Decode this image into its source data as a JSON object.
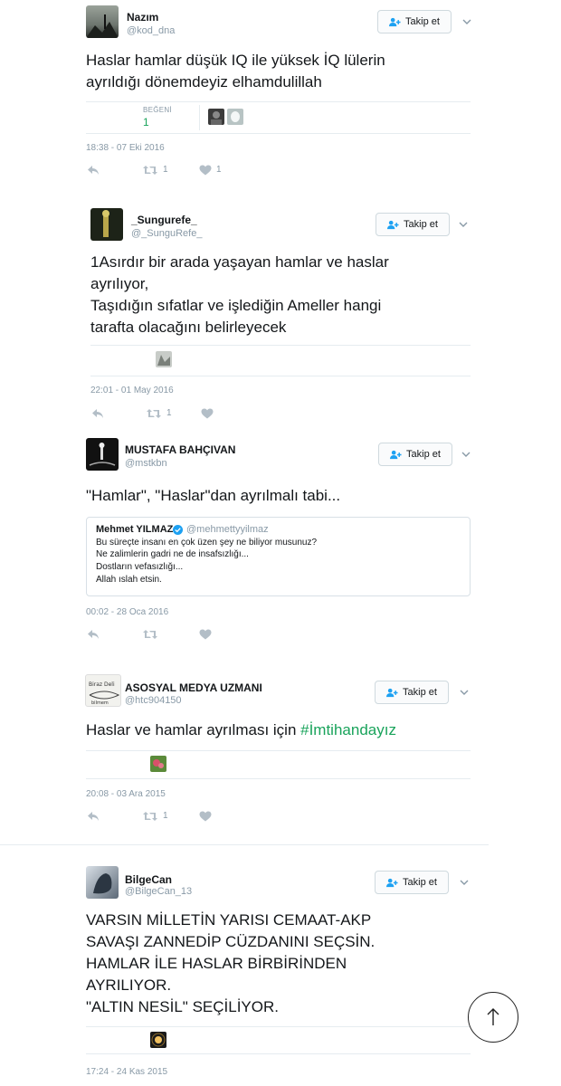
{
  "follow_label": "Takip et",
  "likes_label": "BEĞENİ",
  "colors": {
    "link": "#19a35b",
    "muted": "#8899a6",
    "text": "#14171a",
    "border": "#e6ecf0"
  },
  "tweets": [
    {
      "name": "Nazım",
      "handle": "@kod_dna",
      "lines": [
        "Haslar hamlar düşük IQ ile yüksek İQ lülerin",
        "ayrıldığı dönemdeyiz elhamdulillah"
      ],
      "likes_count": "1",
      "date": "18:38 - 07 Eki 2016",
      "retweets": "1",
      "likes": "1"
    },
    {
      "name": "_Sungurefe_",
      "handle": "@_SunguRefe_",
      "lines": [
        "1Asırdır bir arada yaşayan hamlar ve haslar",
        "ayrılıyor,",
        "Taşıdığın sıfatlar ve işlediğin Ameller hangi",
        "tarafta olacağını belirleyecek"
      ],
      "date": "22:01 - 01 May 2016",
      "retweets": "1"
    },
    {
      "name": "MUSTAFA BAHÇIVAN",
      "handle": "@mstkbn",
      "lines": [
        "\"Hamlar\", \"Haslar\"dan ayrılmalı tabi..."
      ],
      "quote": {
        "name": "Mehmet YILMAZ",
        "handle": "@mehmettyyilmaz",
        "lines": [
          "Bu süreçte insanı en çok üzen şey ne biliyor musunuz?",
          "Ne zalimlerin gadri ne de insafsızlığı...",
          "Dostların vefasızlığı...",
          "Allah ıslah etsin."
        ]
      },
      "date": "00:02 - 28 Oca 2016"
    },
    {
      "name": "ASOSYAL MEDYA UZMANI",
      "handle": "@htc904150",
      "text": "Haslar ve hamlar ayrılması için ",
      "hashtag": "#İmtihandayız",
      "date": "20:08 - 03 Ara 2015",
      "retweets": "1"
    },
    {
      "name": "BilgeCan",
      "handle": "@BilgeCan_13",
      "lines": [
        "VARSIN MİLLETİN YARISI CEMAAT-AKP",
        "SAVAŞI ZANNEDİP CÜZDANINI SEÇSİN.",
        "HAMLAR İLE HASLAR BİRBİRİNDEN",
        "AYRILIYOR.",
        "\"ALTIN NESİL\" SEÇİLİYOR."
      ],
      "date": "17:24 - 24 Kas 2015"
    }
  ]
}
